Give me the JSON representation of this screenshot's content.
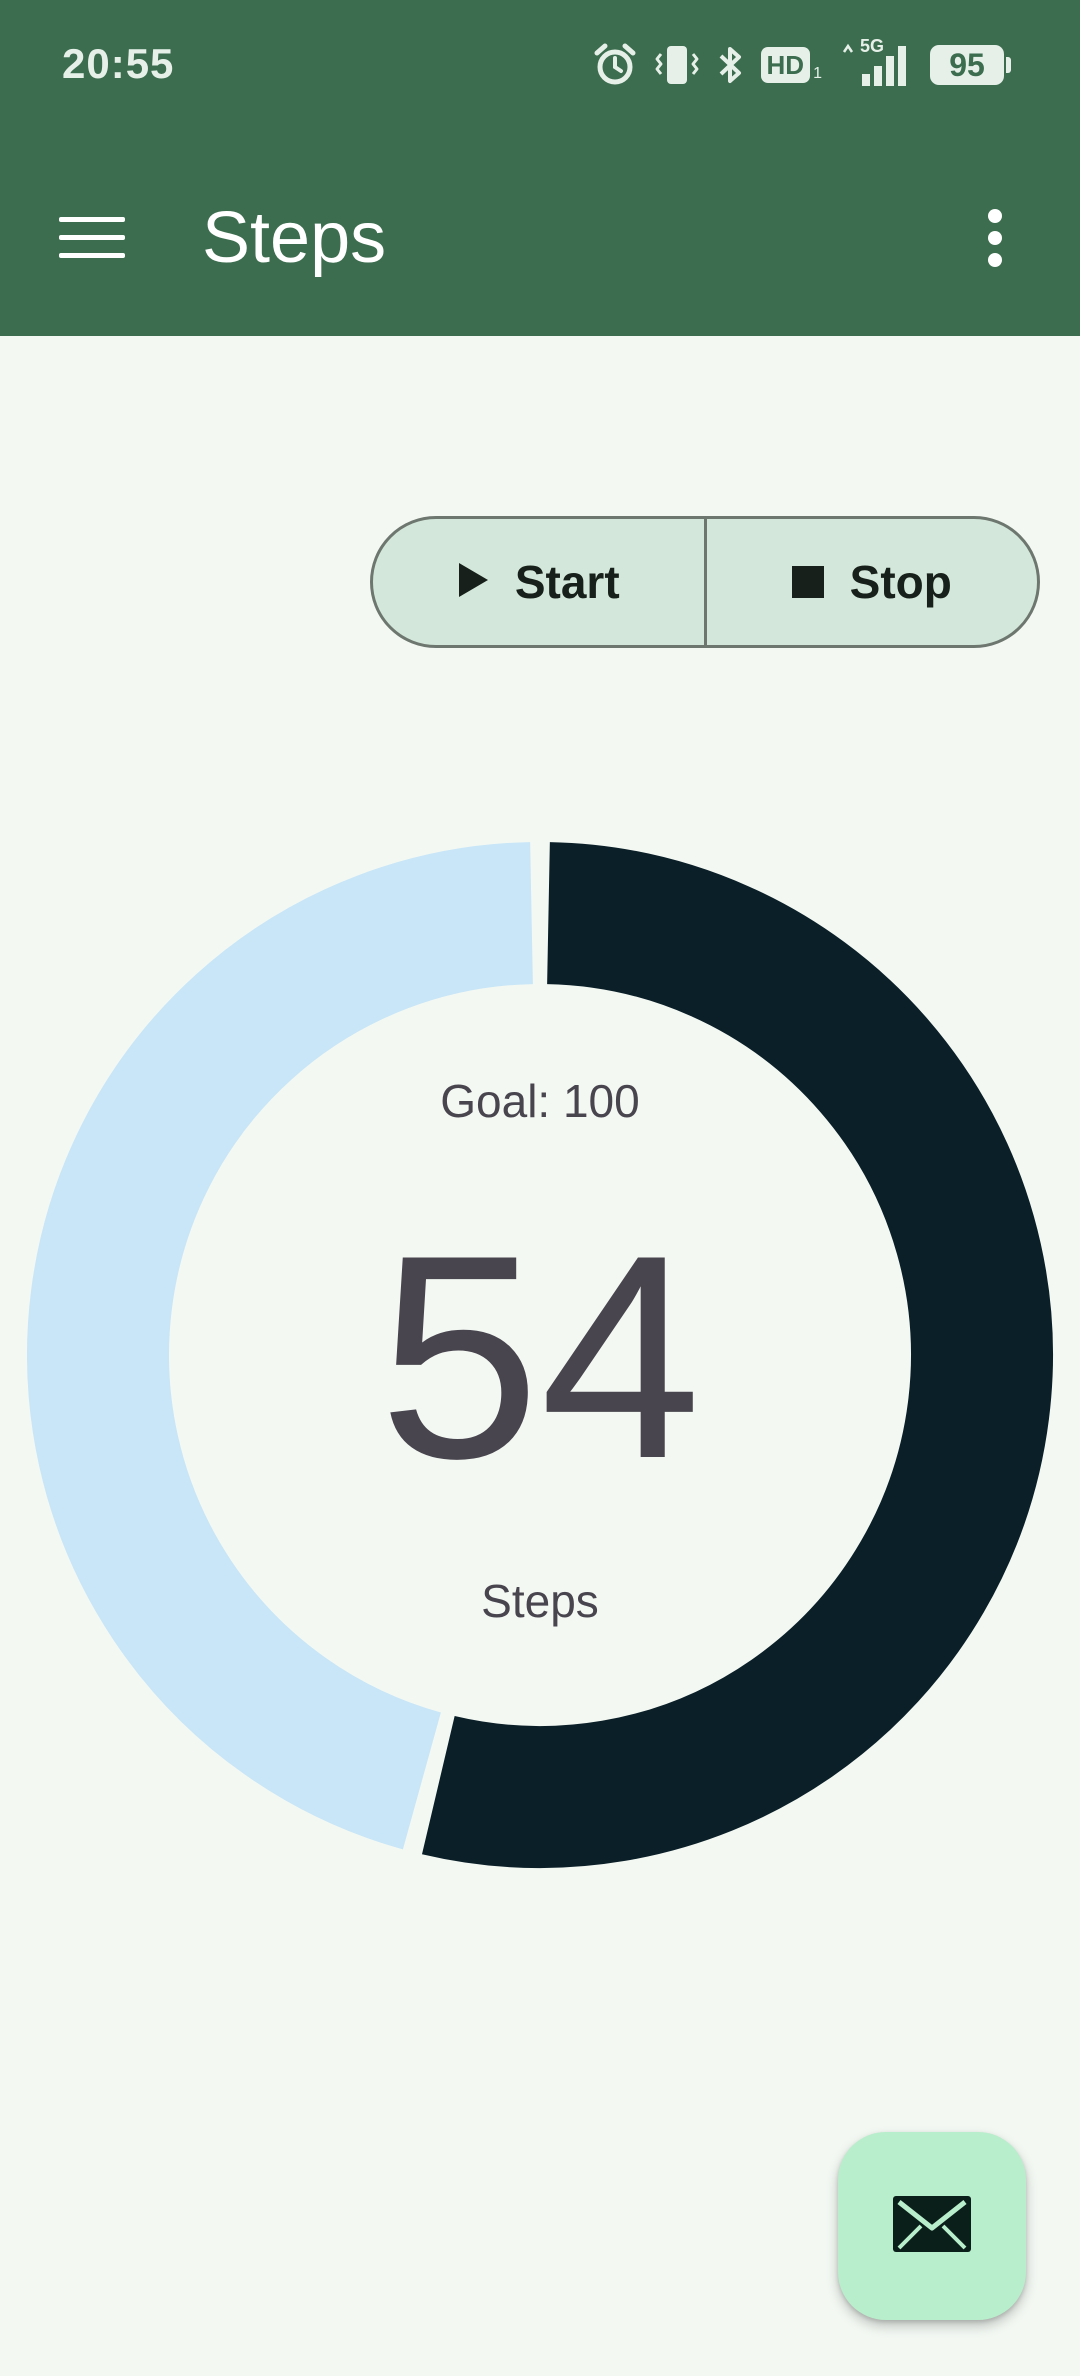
{
  "status_bar": {
    "time": "20:55",
    "hd_label": "HD",
    "network_label": "5G",
    "battery": "95",
    "icons": [
      "alarm-icon",
      "vibrate-icon",
      "bluetooth-icon",
      "hd-icon",
      "signal-icon",
      "battery-icon"
    ]
  },
  "app_bar": {
    "title": "Steps",
    "menu_icon": "hamburger-menu-icon",
    "overflow_icon": "more-vertical-icon",
    "background": "#3B6D4E"
  },
  "controls": {
    "start_label": "Start",
    "stop_label": "Stop",
    "start_icon": "play-icon",
    "stop_icon": "stop-icon"
  },
  "progress": {
    "goal_label": "Goal: 100",
    "goal": 100,
    "steps": 54,
    "count": "54",
    "unit_label": "Steps",
    "progress_color": "#0A1F28",
    "track_color": "#C8E6F7"
  },
  "fab": {
    "icon": "mail-icon",
    "background": "#B8EECB"
  }
}
